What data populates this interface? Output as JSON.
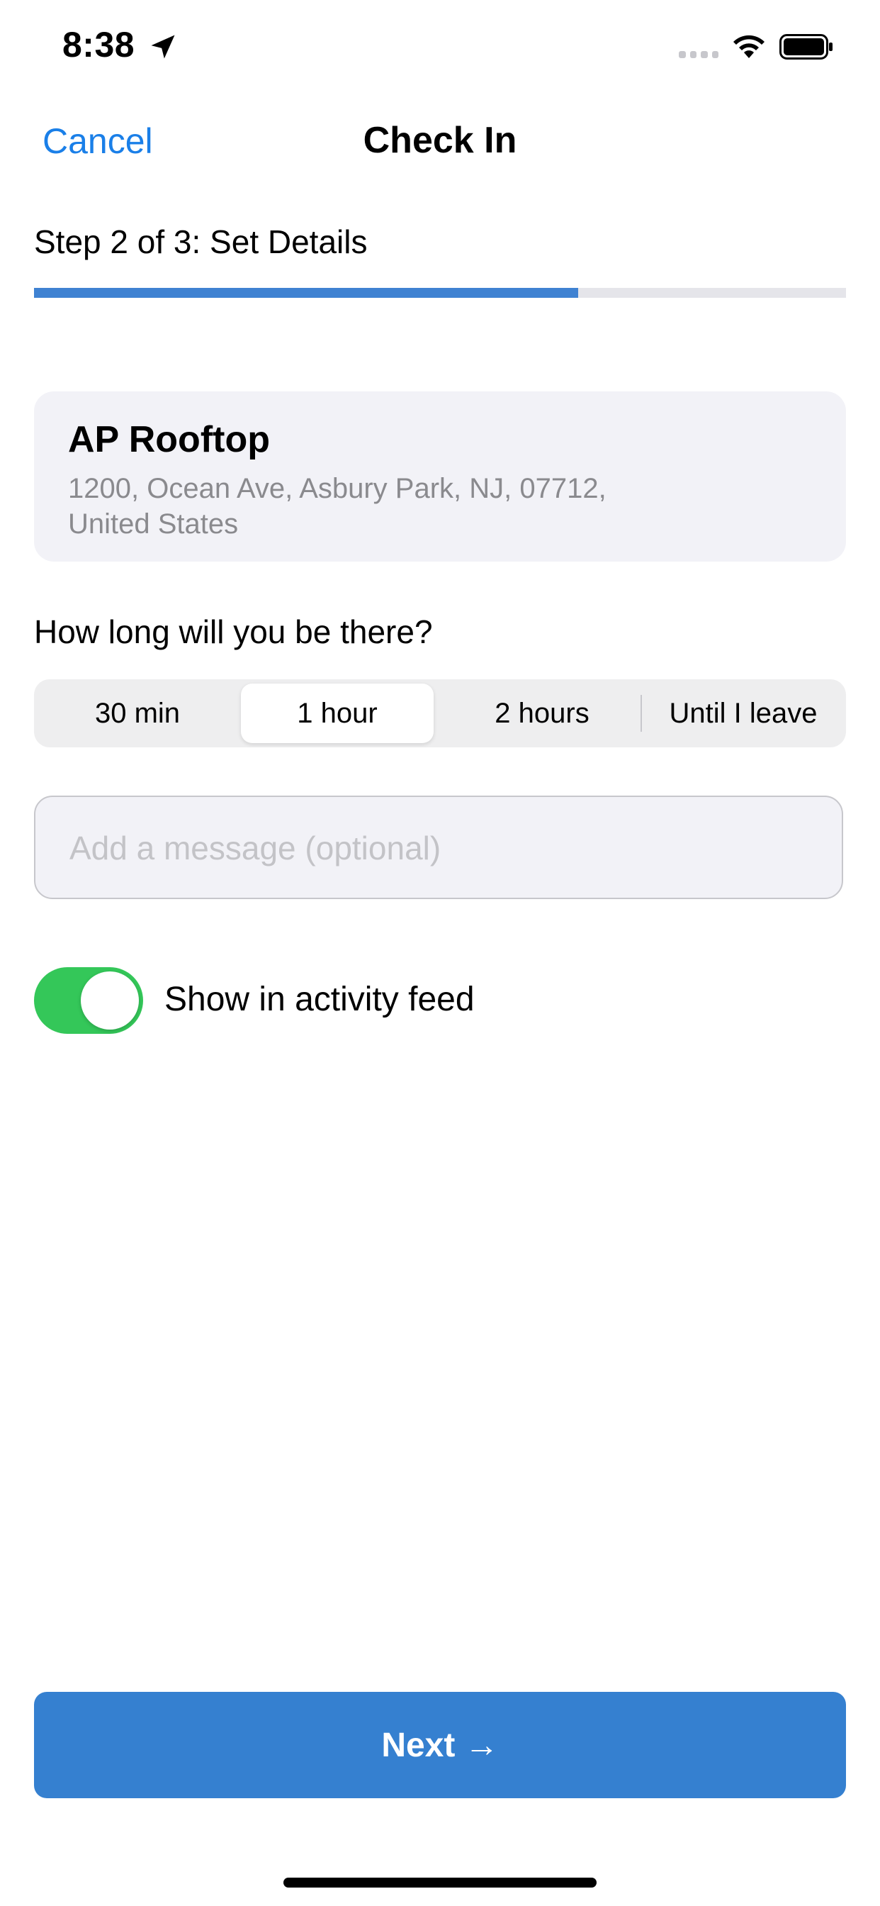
{
  "status_bar": {
    "time": "8:38"
  },
  "nav": {
    "cancel_label": "Cancel",
    "title": "Check In"
  },
  "step": {
    "label": "Step 2 of 3: Set Details",
    "progress": 0.67
  },
  "location": {
    "name": "AP Rooftop",
    "address": "1200, Ocean Ave, Asbury Park, NJ, 07712, United States"
  },
  "duration": {
    "question": "How long will you be there?",
    "options": [
      "30 min",
      "1 hour",
      "2 hours",
      "Until I leave"
    ],
    "selected": "1 hour"
  },
  "message": {
    "placeholder": "Add a message (optional)",
    "value": ""
  },
  "activity_toggle": {
    "label": "Show in activity feed",
    "on": true
  },
  "next_button": {
    "label": "Next →"
  },
  "colors": {
    "accent_blue": "#1a7fe8",
    "progress_blue": "#3f82d2",
    "button_blue": "#3580d0",
    "toggle_green": "#34c759"
  }
}
